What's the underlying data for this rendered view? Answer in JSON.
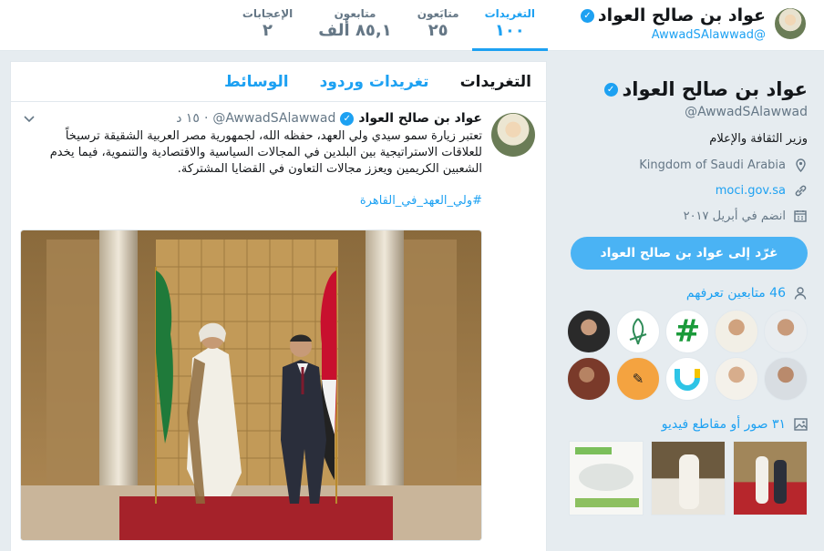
{
  "header": {
    "name": "عواد بن صالح العواد",
    "handle": "@AwwadSAlawwad",
    "verified_mark": "✓",
    "stats": [
      {
        "label": "التغريدات",
        "value": "١٠٠"
      },
      {
        "label": "متابَعون",
        "value": "٢٥"
      },
      {
        "label": "متابعون",
        "value": "٨٥,١ ألف"
      },
      {
        "label": "الإعجابات",
        "value": "٢"
      }
    ]
  },
  "profile": {
    "name": "عواد بن صالح العواد",
    "handle": "@AwwadSAlawwad",
    "bio": "وزير الثقافة والإعلام",
    "location": "Kingdom of Saudi Arabia",
    "website": "moci.gov.sa",
    "joined": "انضم في أبريل ٢٠١٧",
    "tweet_to_button": "غرّد إلى عواد بن صالح العواد",
    "followers_you_know": "46 متابعين تعرفهم",
    "media_count": "٣١ صور أو مقاطع فيديو",
    "icons": {
      "location": "location-pin-icon",
      "link": "link-icon",
      "calendar": "calendar-icon",
      "people": "person-icon",
      "media": "image-icon"
    }
  },
  "timeline": {
    "tabs": [
      "التغريدات",
      "تغريدات وردود",
      "الوسائط"
    ],
    "tweet": {
      "name": "عواد بن صالح العواد",
      "handle": "@AwwadSAlawwad",
      "time": "١٥ د",
      "separator": "·",
      "text": "تعتبر زيارة سمو سيدي ولي العهد، حفظه الله، لجمهورية مصر العربية الشقيقة ترسيخاً للعلاقات الاستراتيجية بين البلدين في المجالات السياسية والاقتصادية والتنموية، فيما يخدم الشعبين الكريمين ويعزز مجالات التعاون في القضايا المشتركة.",
      "hashtag": "#ولي_العهد_في_القاهرة"
    }
  },
  "colors": {
    "accent": "#1da1f2",
    "button": "#4ab3f4",
    "background": "#e6ecf0"
  }
}
